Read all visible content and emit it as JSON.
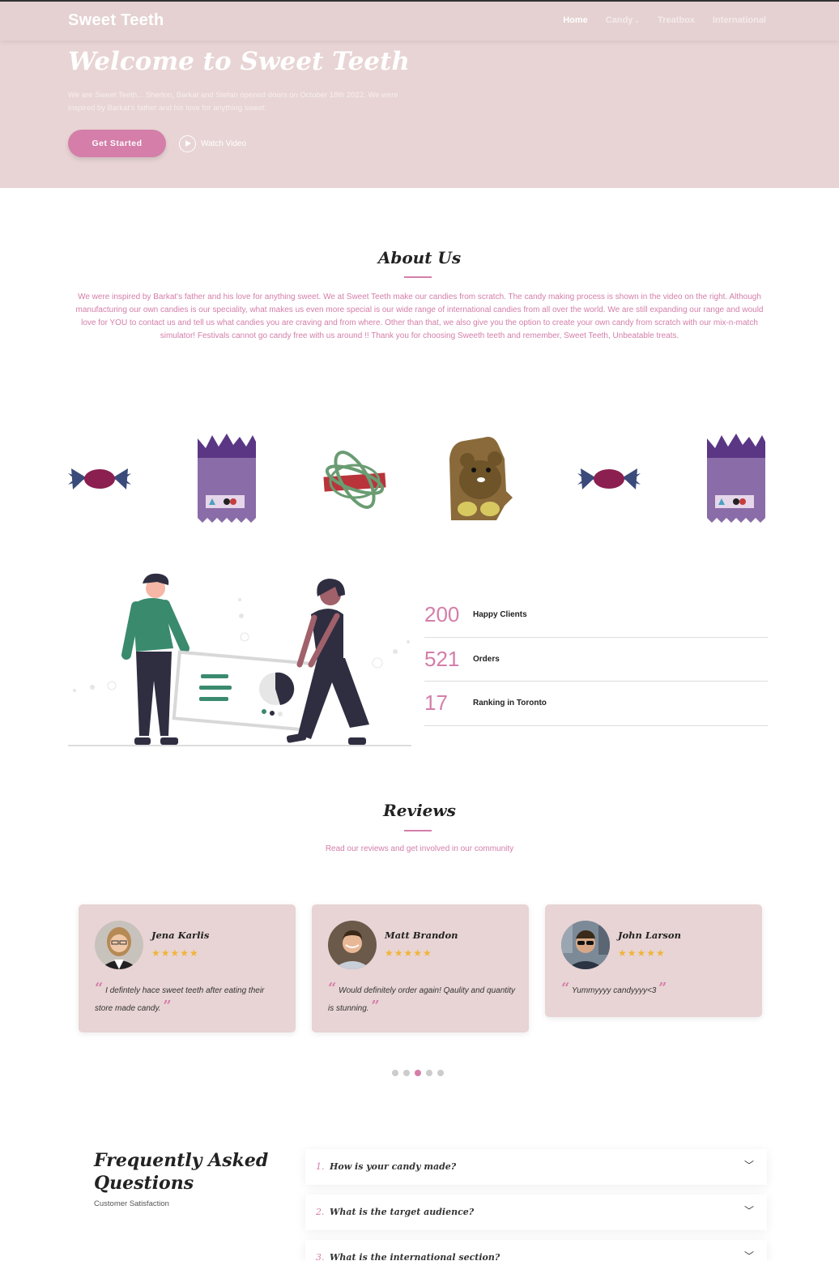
{
  "brand": "Sweet Teeth",
  "nav": {
    "home": "Home",
    "candy": "Candy",
    "treatbox": "Treatbox",
    "international": "International"
  },
  "hero": {
    "title": "Welcome to Sweet Teeth",
    "text": "We are Sweet Teeth... Sherlon, Barkat and Stefan opened doors on October 18th 2022. We were inspired by Barkat's father and his love for anything sweet.",
    "cta": "Get Started",
    "watch": "Watch Video"
  },
  "about": {
    "title": "About Us",
    "text": "We were inspired by Barkat's father and his love for anything sweet. We at Sweet Teeth make our candies from scratch. The candy making process is shown in the video on the right. Although manufacturing our own candies is our speciality, what makes us even more special is our wide range of international candies from all over the world. We are still expanding our range and would love for YOU to contact us and tell us what candies you are craving and from where. Other than that, we also give you the option to create your own candy from scratch with our mix-n-match simulator! Festivals cannot go candy free with us around !! Thank you for choosing Sweeth teeth and remember, Sweet Teeth, Unbeatable treats."
  },
  "stats": [
    {
      "num": "200",
      "label": "Happy Clients"
    },
    {
      "num": "521",
      "label": "Orders"
    },
    {
      "num": "17",
      "label": "Ranking in Toronto"
    }
  ],
  "reviews": {
    "title": "Reviews",
    "subtitle": "Read our reviews and get involved in our community",
    "items": [
      {
        "name": "Jena Karlis",
        "stars": "★★★★★",
        "text": "I defintely hace sweet teeth after eating their store made candy."
      },
      {
        "name": "Matt Brandon",
        "stars": "★★★★★",
        "text": "Would definitely order again! Qaulity and quantity is stunning."
      },
      {
        "name": "John Larson",
        "stars": "★★★★★",
        "text": "Yummyyyy candyyyy<3"
      }
    ]
  },
  "faq": {
    "title_line1": "Frequently Asked",
    "title_line2": "Questions",
    "subtitle": "Customer Satisfaction",
    "items": [
      {
        "num": "1.",
        "q": "How is your candy made?"
      },
      {
        "num": "2.",
        "q": "What is the target audience?"
      },
      {
        "num": "3.",
        "q": "What is the international section?"
      }
    ]
  },
  "colors": {
    "accent": "#d47ea9",
    "hero_bg": "#e8d4d4",
    "star": "#f0b43a"
  }
}
